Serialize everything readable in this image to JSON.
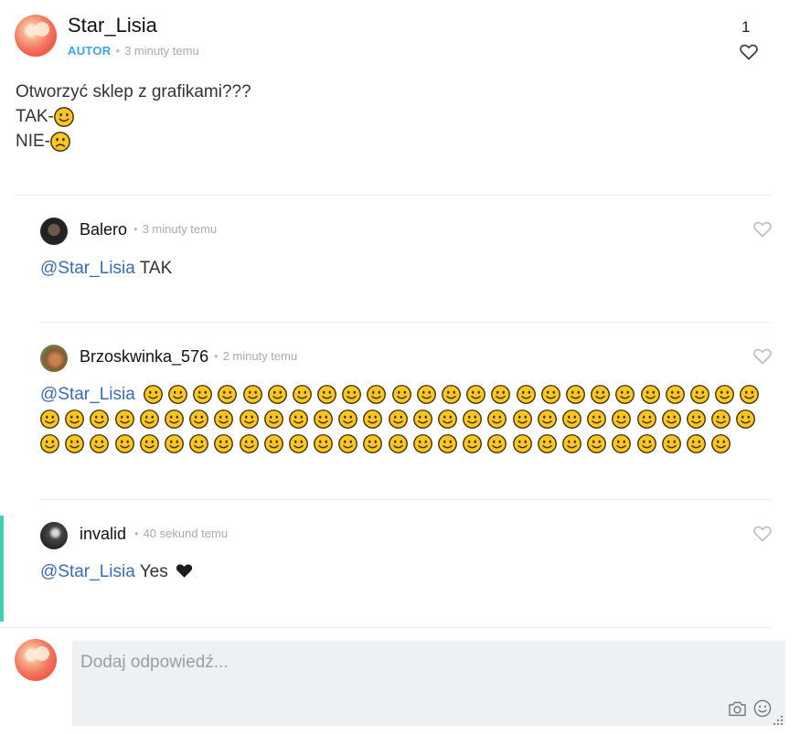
{
  "post": {
    "author": "Star_Lisia",
    "badge": "AUTOR",
    "time": "3 minuty temu",
    "likes": "1",
    "lines": [
      "Otworzyć sklep z grafikami???",
      "TAK-",
      "NIE-"
    ]
  },
  "replies": [
    {
      "name": "Balero",
      "time": "3 minuty temu",
      "mention": "@Star_Lisia",
      "text": "TAK"
    },
    {
      "name": "Brzoskwinka_576",
      "time": "2 minuty temu",
      "mention": "@Star_Lisia",
      "smiley_count": 82
    },
    {
      "name": "invalid",
      "time": "40 sekund temu",
      "mention": "@Star_Lisia",
      "text": "Yes"
    }
  ],
  "reply_box": {
    "placeholder": "Dodaj odpowiedź..."
  },
  "colors": {
    "accent": "#3ecfb0",
    "badge": "#3aa8e0",
    "mention": "#3a6cb0",
    "input_bg": "#eef1f3"
  },
  "icons": [
    "heart-icon",
    "smiling-emoji",
    "frowning-emoji",
    "black-heart-emoji",
    "camera-icon",
    "smile-icon",
    "resize-handle-icon"
  ]
}
